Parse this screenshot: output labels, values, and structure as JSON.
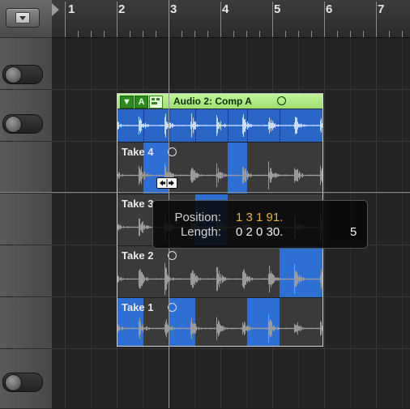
{
  "ruler": {
    "bars": [
      "1",
      "2",
      "3",
      "4",
      "5",
      "6",
      "7"
    ]
  },
  "comp": {
    "title": "Audio 2: Comp A",
    "header_buttons": [
      "▼",
      "A",
      ""
    ],
    "takes": [
      {
        "label": "Take 4"
      },
      {
        "label": "Take 3"
      },
      {
        "label": "Take 2"
      },
      {
        "label": "Take 1"
      }
    ]
  },
  "tooltip": {
    "position_label": "Position:",
    "position_value": "1 3 1 91.",
    "length_label": "Length:",
    "length_value": "0 2 0 30.",
    "extra_value": "5"
  },
  "colors": {
    "comp_header": "#9ddf6e",
    "take_selection": "#2e6fd4",
    "position_value": "#e8b13a"
  }
}
